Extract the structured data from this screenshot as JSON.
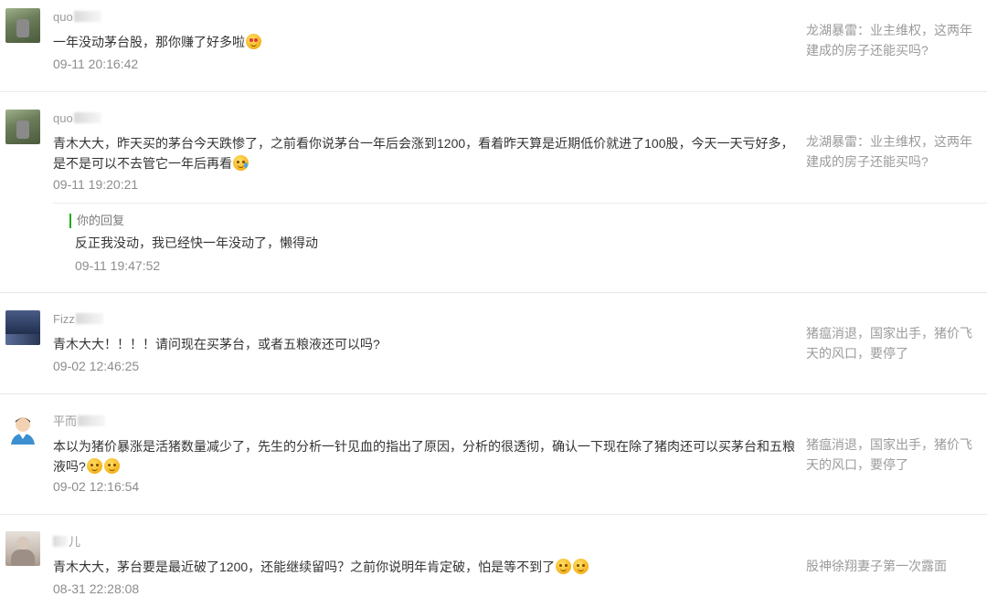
{
  "comments": [
    {
      "nickname": "quo",
      "text": "一年没动茅台股，那你赚了好多啦",
      "time": "09-11 20:16:42",
      "article": "龙湖暴雷：业主维权，这两年建成的房子还能买吗?",
      "avatar_color": "#6b7d5a",
      "emoji": "heart-eyes"
    },
    {
      "nickname": "quo",
      "text": "青木大大，昨天买的茅台今天跌惨了，之前看你说茅台一年后会涨到1200，看着昨天算是近期低价就进了100股，今天一天亏好多，是不是可以不去管它一年后再看",
      "time": "09-11 19:20:21",
      "article": "龙湖暴雷：业主维权，这两年建成的房子还能买吗?",
      "avatar_color": "#6b7d5a",
      "emoji": "cry",
      "reply": {
        "label": "你的回复",
        "text": "反正我没动，我已经快一年没动了，懒得动",
        "time": "09-11 19:47:52"
      }
    },
    {
      "nickname": "Fizz",
      "text": "青木大大！！！！请问现在买茅台，或者五粮液还可以吗?",
      "time": "09-02 12:46:25",
      "article": "猪瘟消退，国家出手，猪价飞天的风口，要停了",
      "avatar_color": "#2b3b5e"
    },
    {
      "nickname": "平而",
      "text": "本以为猪价暴涨是活猪数量减少了，先生的分析一针见血的指出了原因，分析的很透彻，确认一下现在除了猪肉还可以买茅台和五粮液吗?",
      "time": "09-02 12:16:54",
      "article": "猪瘟消退，国家出手，猪价飞天的风口，要停了",
      "avatar_color": "#ffffff",
      "emoji": "smile"
    },
    {
      "nickname": "儿",
      "text": "青木大大，茅台要是最近破了1200，还能继续留吗？之前你说明年肯定破，怕是等不到了",
      "time": "08-31 22:28:08",
      "article": "股神徐翔妻子第一次露面",
      "avatar_color": "#c7bdb4",
      "emoji": "think"
    }
  ]
}
